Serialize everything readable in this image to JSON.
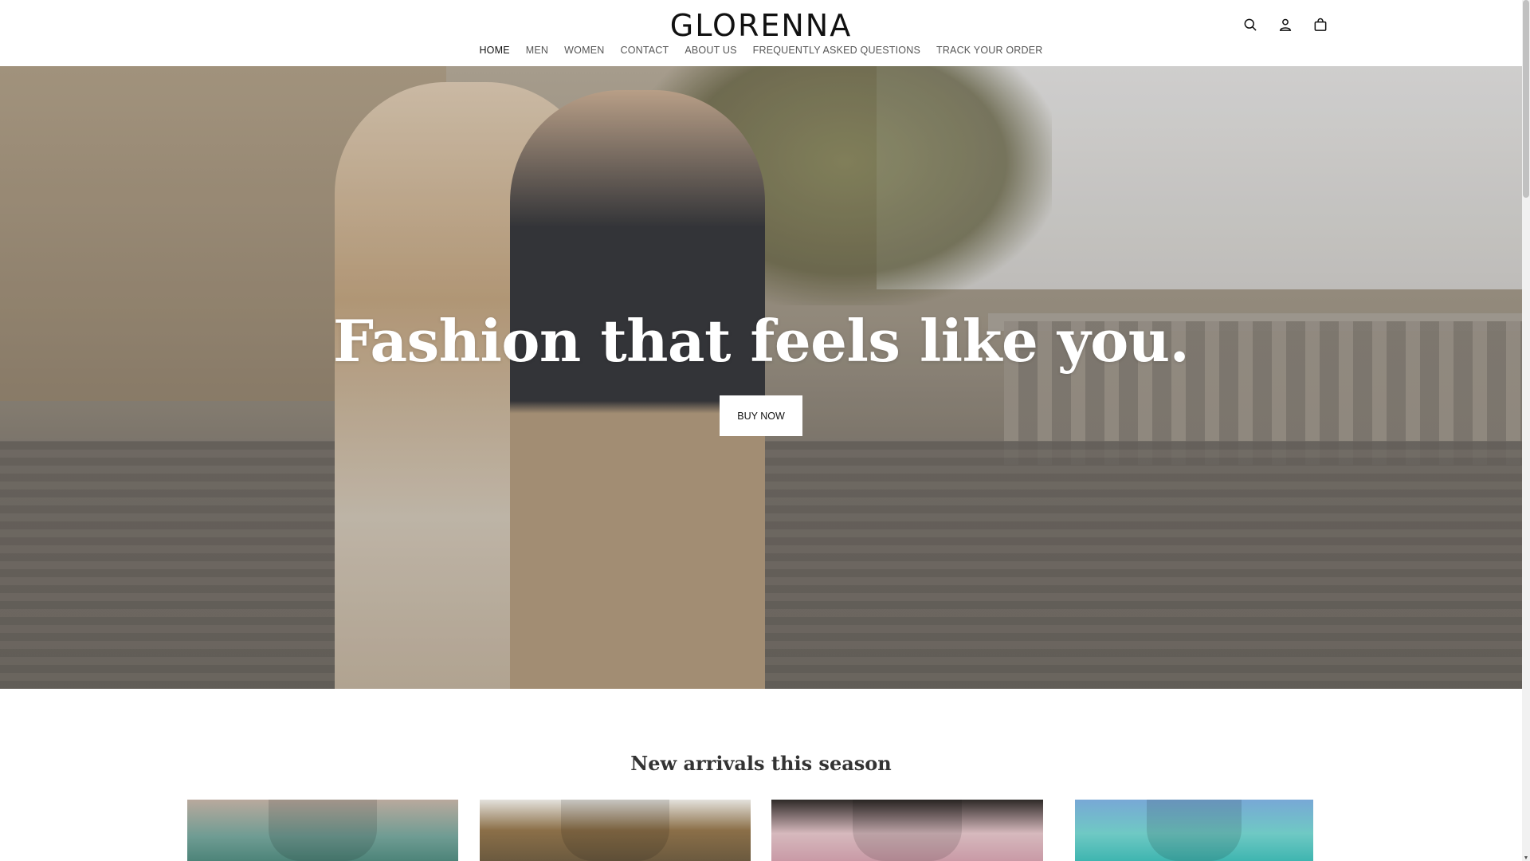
{
  "brand": {
    "logo": "GLORENNA"
  },
  "header": {
    "icons": [
      "search-icon",
      "account-icon",
      "cart-icon"
    ]
  },
  "nav": {
    "items": [
      {
        "label": "HOME",
        "active": true
      },
      {
        "label": "MEN"
      },
      {
        "label": "WOMEN"
      },
      {
        "label": "CONTACT"
      },
      {
        "label": "ABOUT US"
      },
      {
        "label": "FREQUENTLY ASKED QUESTIONS"
      },
      {
        "label": "TRACK YOUR ORDER"
      }
    ]
  },
  "hero": {
    "title": "Fashion that feels like you.",
    "button_label": "BUY NOW"
  },
  "new_arrivals": {
    "title": "New arrivals this season"
  },
  "colors": {
    "background": "#ffffff",
    "text": "#121212",
    "nav_text": "#555555",
    "hero_text": "#ffffff"
  }
}
